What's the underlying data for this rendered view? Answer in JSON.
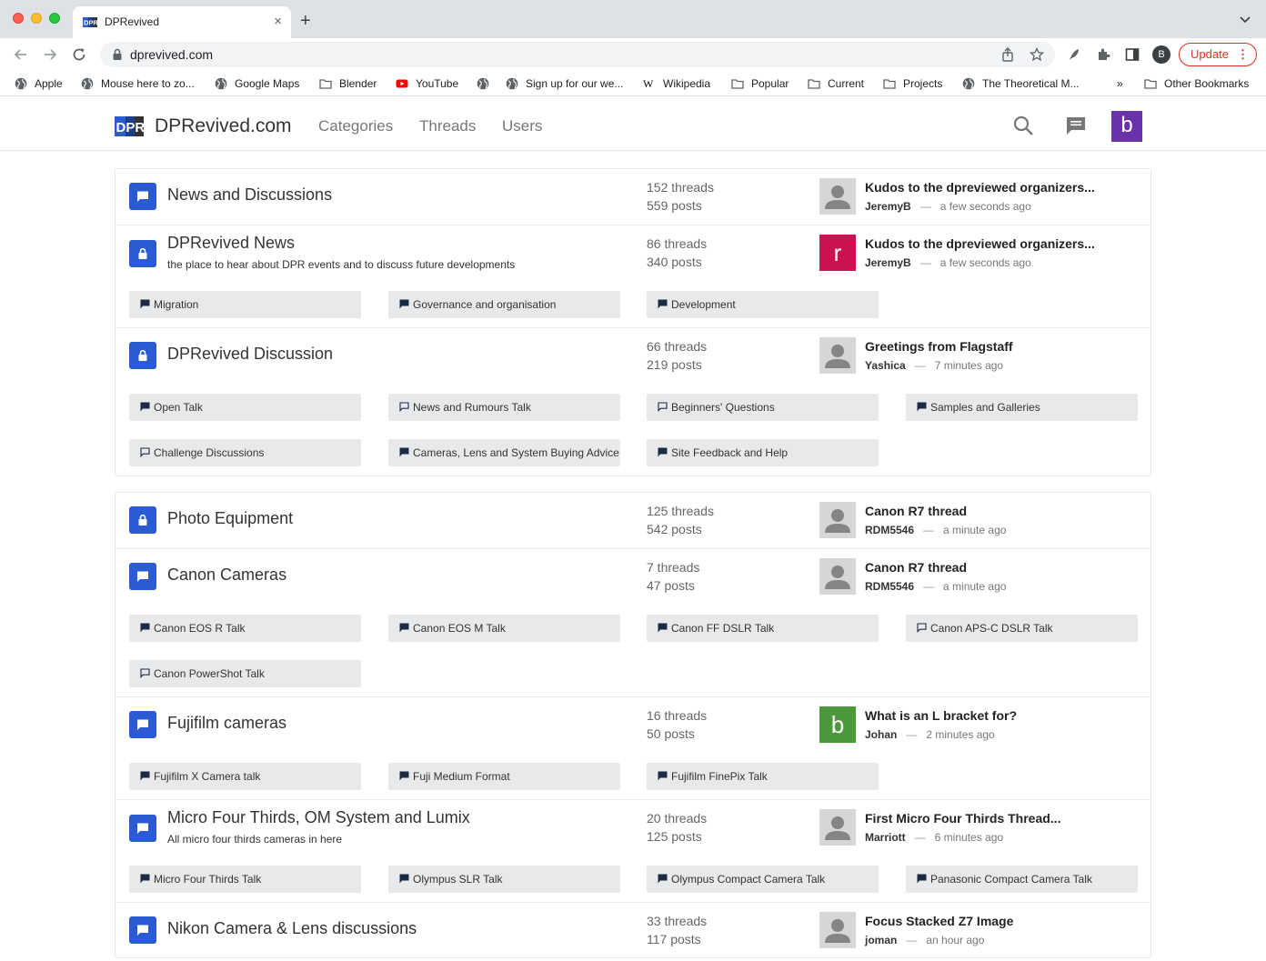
{
  "browser": {
    "tab_title": "DPRevived",
    "tab_close": "×",
    "new_tab": "+",
    "url": "dprevived.com",
    "profile_initial": "B",
    "update_label": "Update",
    "update_dots": "⋮"
  },
  "bookmarks": [
    {
      "label": "Apple",
      "icon": "globe-icon"
    },
    {
      "label": "Mouse here to zo...",
      "icon": "globe-icon"
    },
    {
      "label": "Google Maps",
      "icon": "globe-icon"
    },
    {
      "label": "Blender",
      "icon": "folder-icon"
    },
    {
      "label": "YouTube",
      "icon": "youtube-icon"
    },
    {
      "label": "",
      "icon": "globe-icon"
    },
    {
      "label": "Sign up for our we...",
      "icon": "globe-icon"
    },
    {
      "label": "Wikipedia",
      "icon": "wikipedia-icon"
    },
    {
      "label": "Popular",
      "icon": "folder-icon"
    },
    {
      "label": "Current",
      "icon": "folder-icon"
    },
    {
      "label": "Projects",
      "icon": "folder-icon"
    },
    {
      "label": "The Theoretical M...",
      "icon": "globe-icon"
    },
    {
      "label": "»",
      "icon": ""
    },
    {
      "label": "Other Bookmarks",
      "icon": "folder-icon"
    }
  ],
  "site": {
    "title": "DPRevived.com",
    "nav": [
      "Categories",
      "Threads",
      "Users"
    ],
    "user_initial": "b",
    "colors": {
      "accent": "#2b5bd1",
      "avatar": "#6a32a8"
    }
  },
  "groups": [
    {
      "rows": [
        {
          "name": "News and Discussions",
          "desc": "",
          "icon": "chat-icon",
          "threads": "152 threads",
          "posts": "559 posts",
          "last": {
            "title": "Kudos to the dpreviewed organizers...",
            "user": "JeremyB",
            "sep": "—",
            "time": "a few seconds ago",
            "avatar": "default",
            "letter": "",
            "color": ""
          },
          "subs": []
        },
        {
          "name": "DPRevived News",
          "desc": "the place to hear about DPR events and to discuss future developments",
          "icon": "lock-icon",
          "threads": "86 threads",
          "posts": "340 posts",
          "last": {
            "title": "Kudos to the dpreviewed organizers...",
            "user": "JeremyB",
            "sep": "—",
            "time": "a few seconds ago",
            "avatar": "letter",
            "letter": "r",
            "color": "#c9124f"
          },
          "subs": [
            {
              "label": "Migration",
              "icon": "filled"
            },
            {
              "label": "Governance and organisation",
              "icon": "filled"
            },
            {
              "label": "Development",
              "icon": "filled"
            }
          ]
        },
        {
          "name": "DPRevived Discussion",
          "desc": "",
          "icon": "lock-icon",
          "threads": "66 threads",
          "posts": "219 posts",
          "last": {
            "title": "Greetings from Flagstaff",
            "user": "Yashica",
            "sep": "—",
            "time": "7 minutes ago",
            "avatar": "default",
            "letter": "",
            "color": ""
          },
          "subs": [
            {
              "label": "Open Talk",
              "icon": "filled"
            },
            {
              "label": "News and Rumours Talk",
              "icon": "outline"
            },
            {
              "label": "Beginners' Questions",
              "icon": "outline"
            },
            {
              "label": "Samples and Galleries",
              "icon": "filled"
            },
            {
              "label": "Challenge Discussions",
              "icon": "outline"
            },
            {
              "label": "Cameras, Lens and System Buying Advice",
              "icon": "filled"
            },
            {
              "label": "Site Feedback and Help",
              "icon": "filled"
            }
          ]
        }
      ]
    },
    {
      "rows": [
        {
          "name": "Photo Equipment",
          "desc": "",
          "icon": "lock-icon",
          "threads": "125 threads",
          "posts": "542 posts",
          "last": {
            "title": "Canon R7 thread",
            "user": "RDM5546",
            "sep": "—",
            "time": "a minute ago",
            "avatar": "default",
            "letter": "",
            "color": ""
          },
          "subs": []
        },
        {
          "name": "Canon Cameras",
          "desc": "",
          "icon": "chat-icon",
          "threads": "7 threads",
          "posts": "47 posts",
          "last": {
            "title": "Canon R7 thread",
            "user": "RDM5546",
            "sep": "—",
            "time": "a minute ago",
            "avatar": "default",
            "letter": "",
            "color": ""
          },
          "subs": [
            {
              "label": "Canon EOS R Talk",
              "icon": "filled"
            },
            {
              "label": "Canon EOS M Talk",
              "icon": "filled"
            },
            {
              "label": "Canon FF DSLR Talk",
              "icon": "filled"
            },
            {
              "label": "Canon APS-C DSLR Talk",
              "icon": "outline"
            },
            {
              "label": "Canon PowerShot Talk",
              "icon": "outline"
            }
          ]
        },
        {
          "name": "Fujifilm cameras",
          "desc": "",
          "icon": "chat-icon",
          "threads": "16 threads",
          "posts": "50 posts",
          "last": {
            "title": "What is an L bracket for?",
            "user": "Johan",
            "sep": "—",
            "time": "2 minutes ago",
            "avatar": "letter",
            "letter": "b",
            "color": "#4a9a3a"
          },
          "subs": [
            {
              "label": "Fujifilm X Camera talk",
              "icon": "filled"
            },
            {
              "label": "Fuji Medium Format",
              "icon": "filled"
            },
            {
              "label": "Fujifilm FinePix Talk",
              "icon": "filled"
            }
          ]
        },
        {
          "name": "Micro Four Thirds, OM System and Lumix",
          "desc": "All micro four thirds cameras in here",
          "icon": "chat-icon",
          "threads": "20 threads",
          "posts": "125 posts",
          "last": {
            "title": "First Micro Four Thirds Thread...",
            "user": "Marriott",
            "sep": "—",
            "time": "6 minutes ago",
            "avatar": "default",
            "letter": "",
            "color": ""
          },
          "subs": [
            {
              "label": "Micro Four Thirds Talk",
              "icon": "filled"
            },
            {
              "label": "Olympus SLR Talk",
              "icon": "filled"
            },
            {
              "label": "Olympus Compact Camera Talk",
              "icon": "filled"
            },
            {
              "label": "Panasonic Compact Camera Talk",
              "icon": "filled"
            }
          ]
        },
        {
          "name": "Nikon Camera & Lens discussions",
          "desc": "",
          "icon": "chat-icon",
          "threads": "33 threads",
          "posts": "117 posts",
          "last": {
            "title": "Focus Stacked Z7 Image",
            "user": "joman",
            "sep": "—",
            "time": "an hour ago",
            "avatar": "default",
            "letter": "",
            "color": ""
          },
          "subs": []
        }
      ]
    }
  ]
}
